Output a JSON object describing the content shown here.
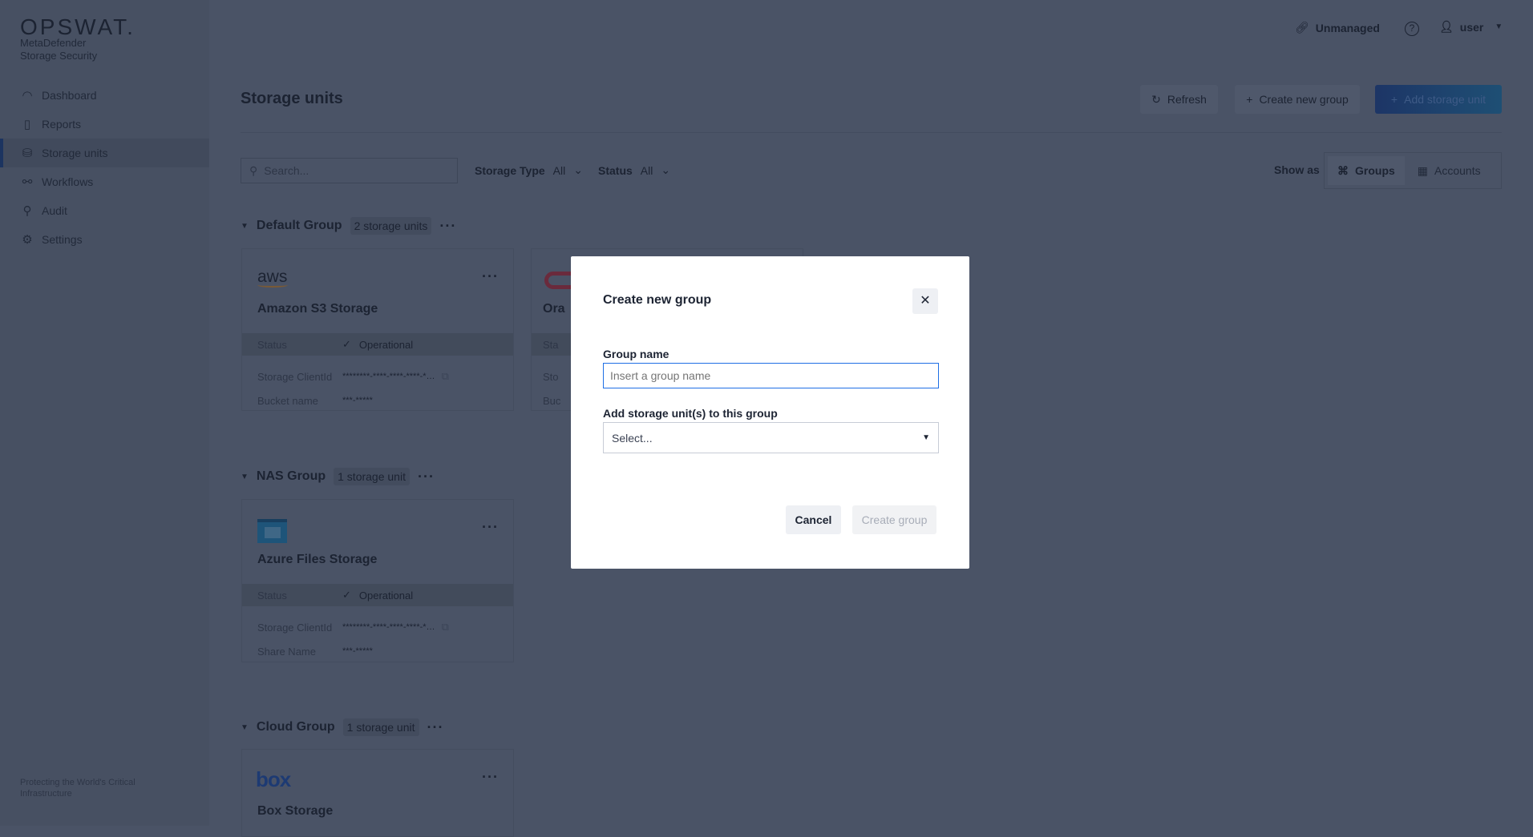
{
  "brand": {
    "logo": "OPSWAT.",
    "product_line1": "MetaDefender",
    "product_line2": "Storage Security",
    "footer": "Protecting the World's Critical Infrastructure"
  },
  "sidebar": {
    "items": [
      {
        "label": "Dashboard",
        "icon": "gauge-icon"
      },
      {
        "label": "Reports",
        "icon": "clipboard-icon"
      },
      {
        "label": "Storage units",
        "icon": "storage-icon",
        "selected": true
      },
      {
        "label": "Workflows",
        "icon": "workflow-icon"
      },
      {
        "label": "Audit",
        "icon": "audit-icon"
      },
      {
        "label": "Settings",
        "icon": "gear-icon"
      }
    ]
  },
  "topbar": {
    "unmanaged": "Unmanaged",
    "user": "user"
  },
  "page": {
    "title": "Storage units",
    "refresh": "Refresh",
    "create_group": "Create new group",
    "add_unit": "Add storage unit",
    "search_placeholder": "Search...",
    "storage_type_label": "Storage Type",
    "storage_type_value": "All",
    "status_label": "Status",
    "status_value": "All",
    "show_as": "Show as",
    "view_groups": "Groups",
    "view_accounts": "Accounts"
  },
  "groups": [
    {
      "name": "Default Group",
      "count": "2 storage units",
      "cards": [
        {
          "logo": "aws",
          "title": "Amazon S3 Storage",
          "status_label": "Status",
          "status": "Operational",
          "k1": "Storage ClientId",
          "v1": "********-****-****-****-*…",
          "k2": "Bucket name",
          "v2": "***-*****"
        },
        {
          "title": "Ora",
          "status_label": "Sta",
          "k1": "Sto",
          "k2": "Buc"
        }
      ]
    },
    {
      "name": "NAS Group",
      "count": "1 storage unit",
      "cards": [
        {
          "title": "Azure Files Storage",
          "status_label": "Status",
          "status": "Operational",
          "k1": "Storage ClientId",
          "v1": "********-****-****-****-*…",
          "k2": "Share Name",
          "v2": "***-*****"
        }
      ]
    },
    {
      "name": "Cloud Group",
      "count": "1 storage unit",
      "cards": [
        {
          "logo": "box",
          "title": "Box Storage"
        }
      ]
    }
  ],
  "modal": {
    "title": "Create new group",
    "group_name_label": "Group name",
    "group_name_placeholder": "Insert a group name",
    "group_name_value": "",
    "units_label": "Add storage unit(s) to this group",
    "units_placeholder": "Select...",
    "cancel": "Cancel",
    "create": "Create group"
  },
  "colors": {
    "accent": "#1d4fa5",
    "aws_orange": "#e8912d",
    "oracle_red": "#c0243a",
    "azure": "#1a78b8",
    "box": "#1b63c6"
  }
}
